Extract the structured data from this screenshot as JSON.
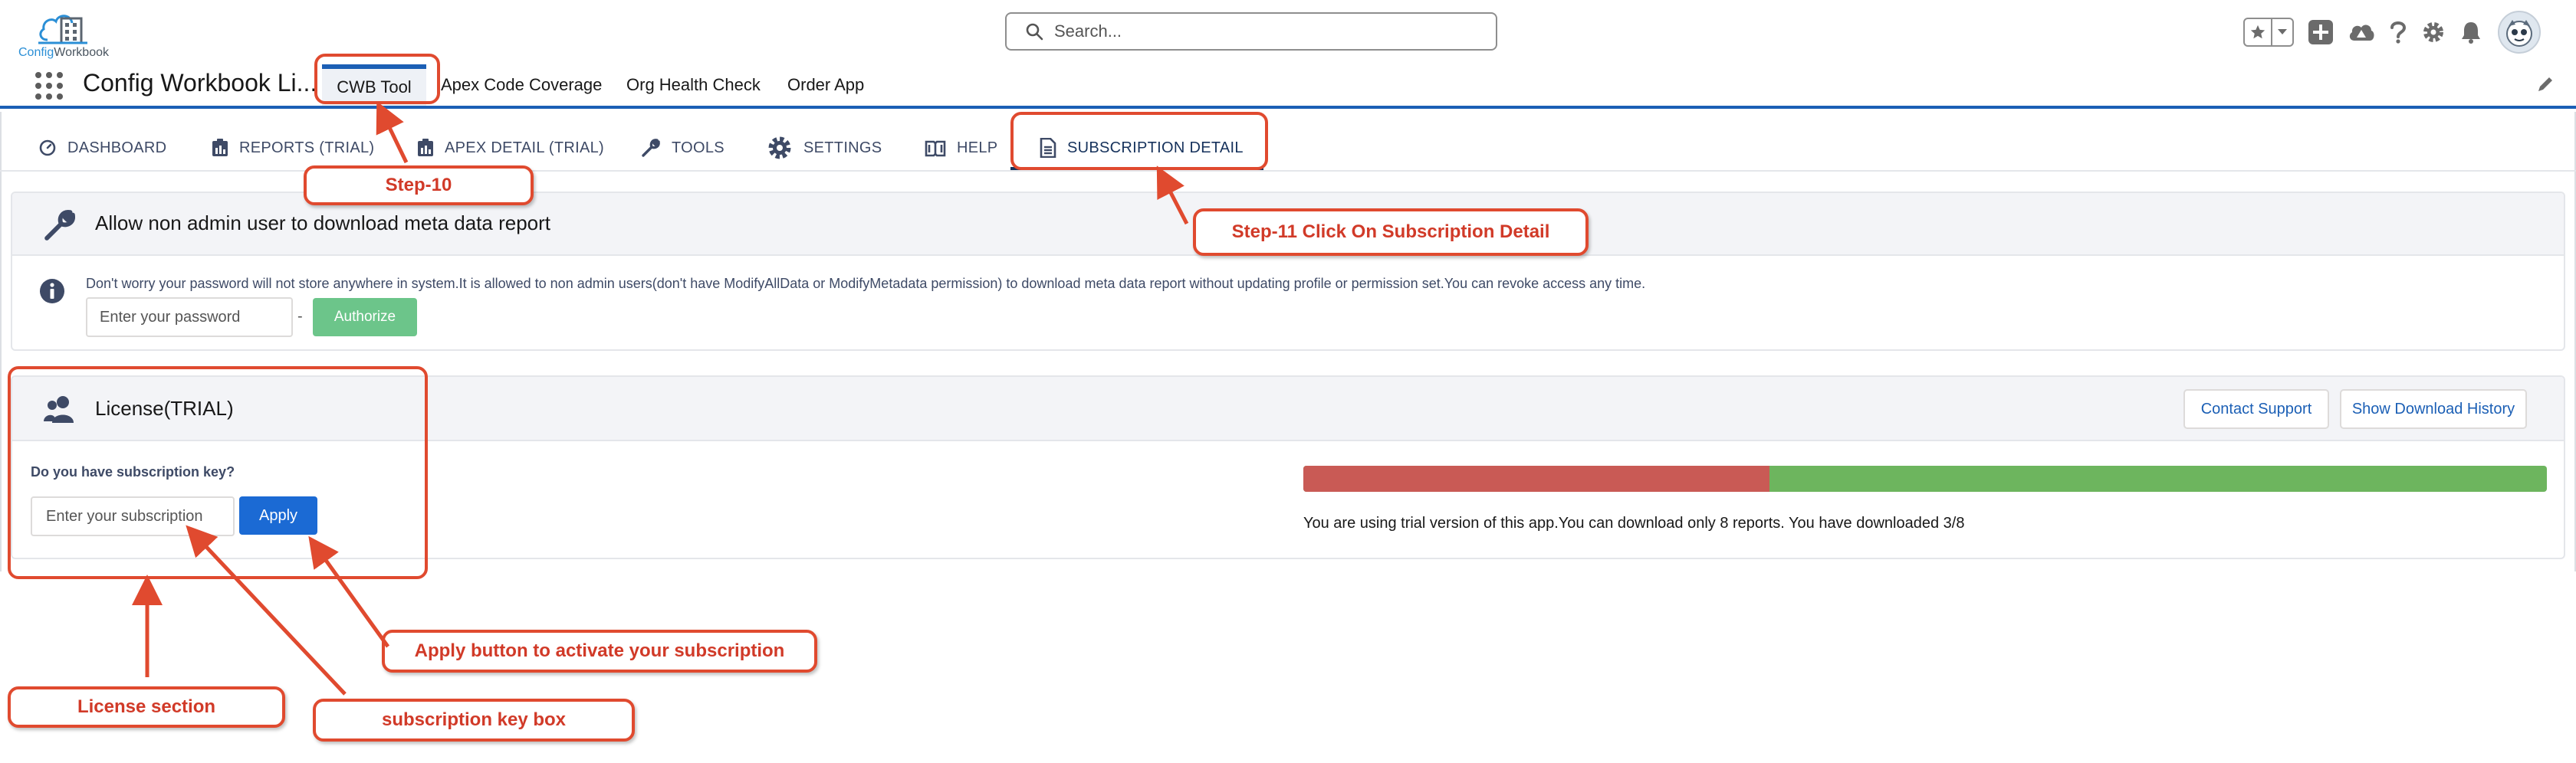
{
  "header": {
    "logo_part1": "Config",
    "logo_part2": "Workbook",
    "search_placeholder": "Search..."
  },
  "app_nav": {
    "app_name": "Config Workbook Li...",
    "tabs": [
      {
        "label": "CWB Tool",
        "active": true
      },
      {
        "label": "Apex Code Coverage",
        "active": false
      },
      {
        "label": "Org Health Check",
        "active": false
      },
      {
        "label": "Order App",
        "active": false
      }
    ]
  },
  "page_tabs": [
    {
      "label": "DASHBOARD",
      "icon": "gauge-icon"
    },
    {
      "label": "REPORTS (TRIAL)",
      "icon": "report-icon"
    },
    {
      "label": "APEX DETAIL (TRIAL)",
      "icon": "report-icon"
    },
    {
      "label": "TOOLS",
      "icon": "wrench-icon"
    },
    {
      "label": "SETTINGS",
      "icon": "gear-icon"
    },
    {
      "label": "HELP",
      "icon": "book-icon"
    },
    {
      "label": "SUBSCRIPTION DETAIL",
      "icon": "document-icon",
      "active": true
    }
  ],
  "metadata_card": {
    "title": "Allow non admin user to download meta data report",
    "info": "Don't worry your password will not store anywhere in system.It is allowed to non admin users(don't have ModifyAllData or ModifyMetadata permission) to download meta data report without updating profile or permission set.You can revoke access any time.",
    "password_placeholder": "Enter your password",
    "separator": "-",
    "authorize_label": "Authorize"
  },
  "license_card": {
    "title": "License(TRIAL)",
    "contact_support_label": "Contact Support",
    "download_history_label": "Show Download History",
    "question": "Do you have subscription key?",
    "subscription_placeholder": "Enter your subscription",
    "apply_label": "Apply",
    "downloaded": 3,
    "limit": 8,
    "trial_message": "You are using trial version of this app.You can download only 8 reports. You have downloaded 3/8"
  },
  "annotations": {
    "step10": "Step-10",
    "step11": "Step-11 Click On Subscription Detail",
    "apply_note": "Apply button to activate your subscription",
    "license_note": "License section",
    "key_note": "subscription key box"
  },
  "colors": {
    "brand_blue": "#1b5fb5",
    "progress_used": "#c95a55",
    "progress_remaining": "#6db55e",
    "authorize_green": "#6cc58a",
    "annotation_red": "#e04a2f"
  }
}
